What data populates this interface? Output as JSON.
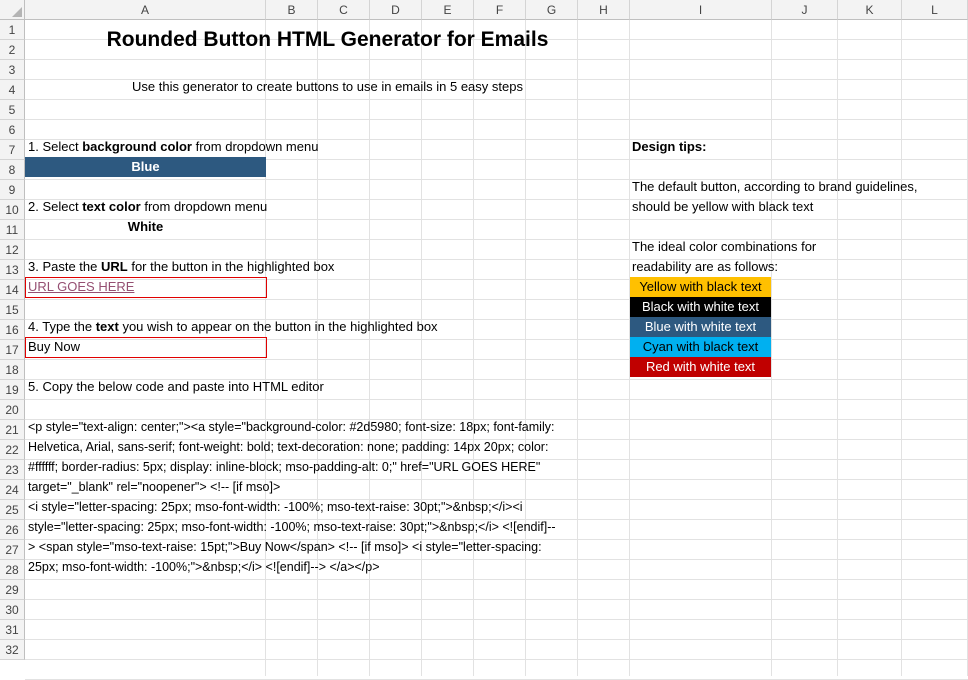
{
  "sheet": {
    "columns": [
      "A",
      "B",
      "C",
      "D",
      "E",
      "F",
      "G",
      "H",
      "I",
      "J",
      "K",
      "L"
    ],
    "rows": [
      "1",
      "2",
      "3",
      "4",
      "5",
      "6",
      "7",
      "8",
      "9",
      "10",
      "11",
      "12",
      "13",
      "14",
      "15",
      "16",
      "17",
      "18",
      "19",
      "20",
      "21",
      "22",
      "23",
      "24",
      "25",
      "26",
      "27",
      "28",
      "29",
      "30",
      "31",
      "32"
    ]
  },
  "content": {
    "title": "Rounded Button HTML Generator for Emails",
    "subtitle": "Use this generator to create buttons to use in emails in 5 easy steps",
    "step1": {
      "pre": "1. Select ",
      "bold": "background color",
      "post": " from dropdown menu"
    },
    "step1_value": "Blue",
    "step2": {
      "pre": "2. Select ",
      "bold": "text color",
      "post": " from dropdown menu"
    },
    "step2_value": "White",
    "step3": {
      "pre": "3. Paste the ",
      "bold": "URL",
      "post": " for the button in the highlighted box"
    },
    "step3_value": "URL GOES HERE",
    "step4": {
      "pre": "4. Type the ",
      "bold": "text",
      "post": " you wish to appear on the button in the highlighted box"
    },
    "step4_value": "Buy Now",
    "step5": "5. Copy the below code and paste into  HTML editor",
    "code_lines": [
      "<p style=\"text-align: center;\"><a style=\"background-color: #2d5980; font-size: 18px; font-family:",
      "Helvetica, Arial, sans-serif; font-weight: bold; text-decoration: none; padding: 14px 20px; color:",
      "#ffffff; border-radius: 5px; display: inline-block; mso-padding-alt: 0;\" href=\"URL GOES HERE\"",
      "target=\"_blank\" rel=\"noopener\"> <!-- [if mso]>",
      "   <i style=\"letter-spacing: 25px; mso-font-width: -100%; mso-text-raise: 30pt;\">&nbsp;</i><i",
      "style=\"letter-spacing: 25px; mso-font-width: -100%; mso-text-raise: 30pt;\">&nbsp;</i>  <![endif]--",
      "> <span style=\"mso-text-raise: 15pt;\">Buy Now</span> <!-- [if mso]>   <i style=\"letter-spacing:",
      "25px; mso-font-width: -100%;\">&nbsp;</i> <![endif]--> </a></p>"
    ]
  },
  "tips": {
    "heading": "Design tips:",
    "default_line1": "The default button, according to brand guidelines,",
    "default_line2": "should be yellow with black text",
    "ideal_line1": "The ideal color combinations for",
    "ideal_line2": "readability are as follows:",
    "combos": [
      {
        "label": "Yellow with black text",
        "bg": "#ffc000",
        "fg": "#000000"
      },
      {
        "label": "Black with white text",
        "bg": "#000000",
        "fg": "#ffffff"
      },
      {
        "label": "Blue with white text",
        "bg": "#2d5980",
        "fg": "#ffffff"
      },
      {
        "label": "Cyan with black text",
        "bg": "#00b0f0",
        "fg": "#000000"
      },
      {
        "label": "Red with white text",
        "bg": "#c00000",
        "fg": "#ffffff"
      }
    ]
  },
  "colors": {
    "accent_blue": "#2d5980",
    "highlight_border": "#e00000",
    "link": "#954f72"
  }
}
